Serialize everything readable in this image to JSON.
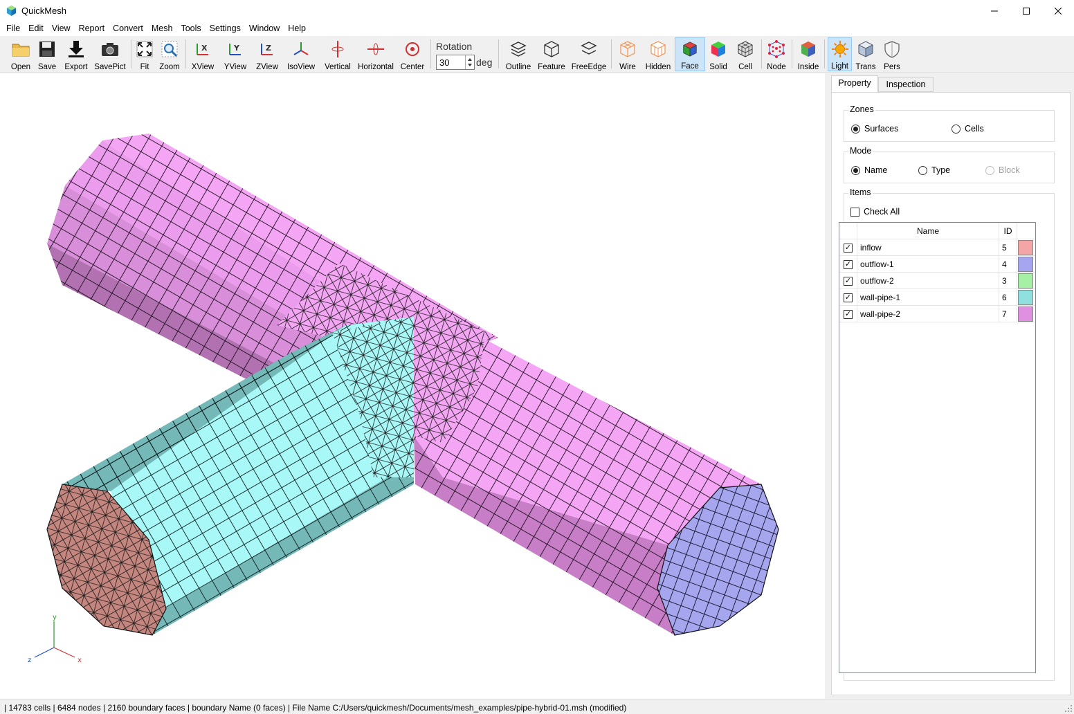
{
  "window": {
    "title": "QuickMesh"
  },
  "menu": [
    "File",
    "Edit",
    "View",
    "Report",
    "Convert",
    "Mesh",
    "Tools",
    "Settings",
    "Window",
    "Help"
  ],
  "toolbar": {
    "open": "Open",
    "save": "Save",
    "export": "Export",
    "savepict": "SavePict",
    "fit": "Fit",
    "zoom": "Zoom",
    "xview": "XView",
    "yview": "YView",
    "zview": "ZView",
    "isoview": "IsoView",
    "vertical": "Vertical",
    "horizontal": "Horizontal",
    "center": "Center",
    "rotation_label": "Rotation",
    "rotation_value": "30",
    "rotation_unit": "deg",
    "outline": "Outline",
    "feature": "Feature",
    "freeedge": "FreeEdge",
    "wire": "Wire",
    "hidden": "Hidden",
    "face": "Face",
    "solid": "Solid",
    "cell": "Cell",
    "node": "Node",
    "inside": "Inside",
    "light": "Light",
    "trans": "Trans",
    "pers": "Pers",
    "active": [
      "Face",
      "Light"
    ]
  },
  "axes": {
    "x": "x",
    "y": "y",
    "z": "z"
  },
  "panel": {
    "tabs": [
      "Property",
      "Inspection"
    ],
    "active_tab": "Property",
    "zones": {
      "title": "Zones",
      "options": [
        "Surfaces",
        "Cells"
      ],
      "selected": "Surfaces"
    },
    "mode": {
      "title": "Mode",
      "options": [
        "Name",
        "Type",
        "Block"
      ],
      "selected": "Name",
      "disabled": [
        "Block"
      ]
    },
    "items": {
      "title": "Items",
      "check_all": "Check All",
      "columns": {
        "name": "Name",
        "id": "ID"
      },
      "rows": [
        {
          "name": "inflow",
          "id": "5",
          "checked": true,
          "color": "#f4a6a6"
        },
        {
          "name": "outflow-1",
          "id": "4",
          "checked": true,
          "color": "#a6a6f0"
        },
        {
          "name": "outflow-2",
          "id": "3",
          "checked": true,
          "color": "#a6f0a6"
        },
        {
          "name": "wall-pipe-1",
          "id": "6",
          "checked": true,
          "color": "#90e0e0"
        },
        {
          "name": "wall-pipe-2",
          "id": "7",
          "checked": true,
          "color": "#e090e0"
        }
      ]
    }
  },
  "status": {
    "text": "| 14783 cells | 6484 nodes | 2160 boundary faces |  boundary Name  (0 faces) | File Name C:/Users/quickmesh/Documents/mesh_examples/pipe-hybrid-01.msh (modified)"
  },
  "colors": {
    "wall_pipe_2_light": "#f4a6f4",
    "wall_pipe_2_dark": "#c77ec7",
    "wall_pipe_1_light": "#a8f8f8",
    "wall_pipe_1_dark": "#74b8b8",
    "inflow": "#c4867e",
    "outflow_1": "#a6a6ee"
  }
}
